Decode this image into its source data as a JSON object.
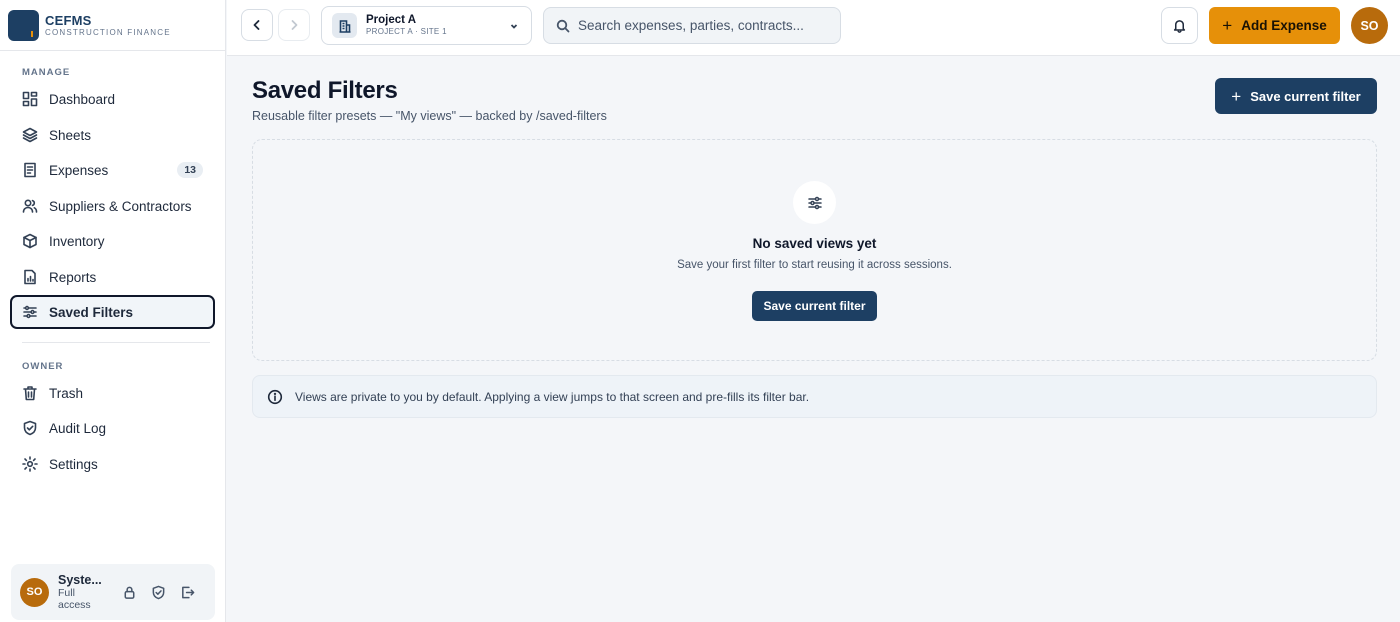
{
  "brand": {
    "name": "CEFMS",
    "subtitle": "CONSTRUCTION FINANCE"
  },
  "sidebar": {
    "manage_label": "MANAGE",
    "owner_label": "OWNER",
    "items": [
      {
        "label": "Dashboard",
        "icon": "dashboard-icon"
      },
      {
        "label": "Sheets",
        "icon": "layers-icon"
      },
      {
        "label": "Expenses",
        "icon": "receipt-icon",
        "badge": "13"
      },
      {
        "label": "Suppliers & Contractors",
        "icon": "users-icon"
      },
      {
        "label": "Inventory",
        "icon": "box-icon"
      },
      {
        "label": "Reports",
        "icon": "report-icon"
      },
      {
        "label": "Saved Filters",
        "icon": "sliders-icon",
        "active": true
      }
    ],
    "owner_items": [
      {
        "label": "Trash",
        "icon": "trash-icon"
      },
      {
        "label": "Audit Log",
        "icon": "shield-check-icon"
      },
      {
        "label": "Settings",
        "icon": "gear-icon"
      }
    ]
  },
  "user": {
    "initials": "SO",
    "name": "Syste...",
    "role": "Full access"
  },
  "topbar": {
    "project": {
      "name": "Project A",
      "subtitle": "PROJECT A · SITE 1"
    },
    "search_placeholder": "Search expenses, parties, contracts...",
    "add_expense_label": "Add Expense",
    "avatar_initials": "SO"
  },
  "main": {
    "title": "Saved Filters",
    "subtitle": "Reusable filter presets — \"My views\" — backed by /saved-filters",
    "save_button_label": "Save current filter",
    "empty": {
      "title": "No saved views yet",
      "description": "Save your first filter to start reusing it across sessions.",
      "button_label": "Save current filter"
    },
    "info": "Views are private to you by default. Applying a view jumps to that screen and pre-fills its filter bar."
  },
  "colors": {
    "primary": "#1d3f63",
    "accent": "#e69009",
    "avatar": "#b86b0c"
  }
}
